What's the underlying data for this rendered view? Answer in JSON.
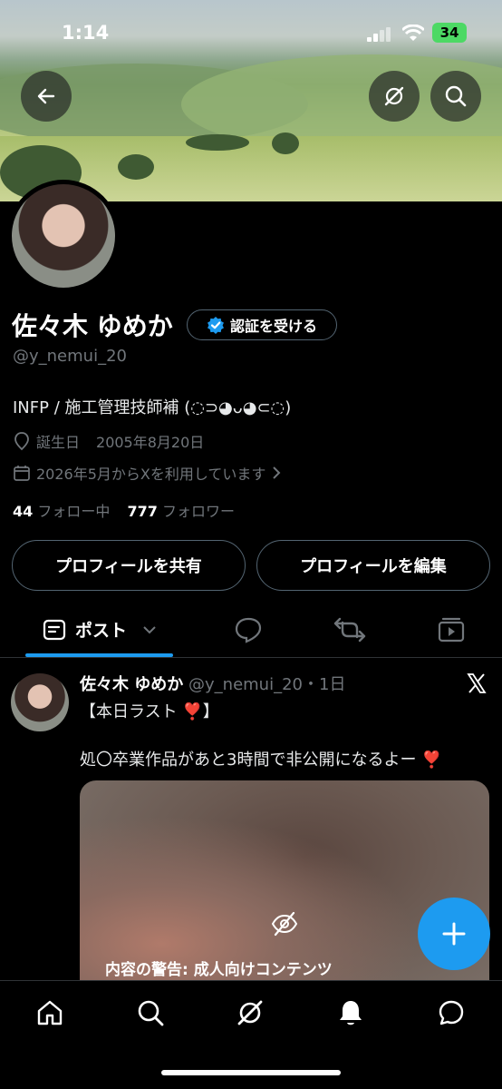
{
  "status": {
    "time": "1:14",
    "battery": "34"
  },
  "profile": {
    "name": "佐々木 ゆめか",
    "verify_label": "認証を受ける",
    "handle": "@y_nemui_20",
    "bio": "INFP / 施工管理技師補 (◌⊃◕ᴗ◕⊂◌)",
    "birthday_label": "誕生日",
    "birthday": "2005年8月20日",
    "joined": "2026年5月からXを利用しています",
    "following_count": "44",
    "following_label": "フォロー中",
    "followers_count": "777",
    "followers_label": "フォロワー",
    "share_label": "プロフィールを共有",
    "edit_label": "プロフィールを編集"
  },
  "tabs": {
    "posts_label": "ポスト"
  },
  "post": {
    "author": "佐々木 ゆめか",
    "meta": "@y_nemui_20・1日",
    "line1": "【本日ラスト ❣️】",
    "line2": "処〇卒業作品があと3時間で非公開になるよー ❣️",
    "warning": "内容の警告: 成人向けコンテンツ"
  },
  "colors": {
    "accent": "#1d9bf0",
    "background": "#000000",
    "muted": "#71767b"
  },
  "icons": [
    "back-arrow-icon",
    "grok-icon",
    "search-icon",
    "verified-badge-icon",
    "location-icon",
    "calendar-icon",
    "chevron-right-icon",
    "posts-icon",
    "chevron-down-icon",
    "reply-icon",
    "repost-icon",
    "media-icon",
    "x-logo-icon",
    "hidden-eye-icon",
    "plus-icon",
    "home-icon",
    "bell-icon",
    "messages-icon"
  ]
}
